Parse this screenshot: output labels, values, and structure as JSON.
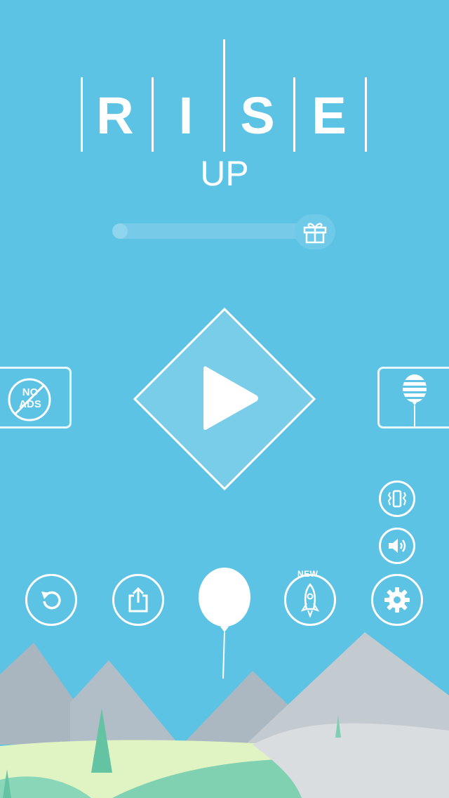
{
  "title": {
    "letters": [
      "R",
      "I",
      "S",
      "E"
    ],
    "subtitle": "UP"
  },
  "progress": {
    "value": 0.08
  },
  "colors": {
    "sky": "#5dc3e5",
    "mountain_gray": "#a8b5bf",
    "grass_light": "#dff3c3",
    "grass_teal": "#74cdb0",
    "tree": "#63c3a2"
  },
  "buttons": {
    "gift": {
      "icon": "gift-icon"
    },
    "play": {
      "icon": "play-icon"
    },
    "no_ads": {
      "label_line1": "NO",
      "label_line2": "ADS",
      "icon": "no-ads-icon"
    },
    "balloon_skins": {
      "icon": "striped-balloon-icon"
    },
    "vibration": {
      "icon": "vibration-icon"
    },
    "sound": {
      "icon": "speaker-icon"
    },
    "restore": {
      "icon": "restore-icon"
    },
    "share": {
      "icon": "share-icon"
    },
    "rocket": {
      "icon": "rocket-icon",
      "badge": "NEW"
    },
    "settings": {
      "icon": "gear-icon"
    }
  }
}
